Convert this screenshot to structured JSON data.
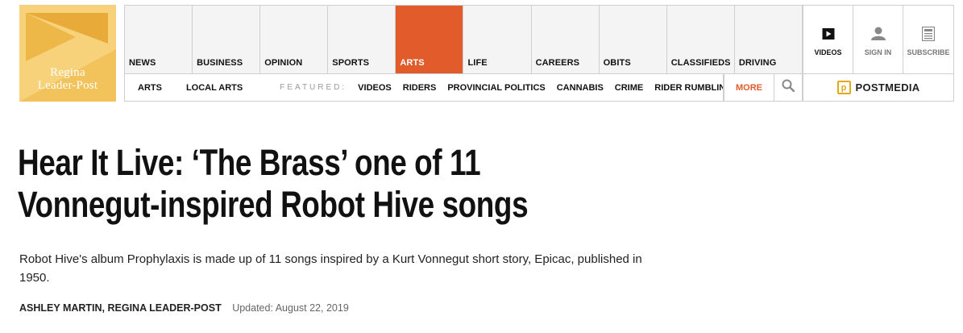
{
  "logo": {
    "line1": "Regina",
    "line2": "Leader-Post",
    "colors": {
      "base": "#f2c35a",
      "dark": "#e8ab3a",
      "light": "#f7d27a"
    }
  },
  "main_nav": [
    {
      "label": "NEWS",
      "active": false
    },
    {
      "label": "BUSINESS",
      "active": false
    },
    {
      "label": "OPINION",
      "active": false
    },
    {
      "label": "SPORTS",
      "active": false
    },
    {
      "label": "ARTS",
      "active": true
    },
    {
      "label": "LIFE",
      "active": false
    },
    {
      "label": "CAREERS",
      "active": false
    },
    {
      "label": "OBITS",
      "active": false
    },
    {
      "label": "CLASSIFIEDS",
      "active": false
    },
    {
      "label": "DRIVING",
      "active": false
    }
  ],
  "utility": {
    "videos": {
      "label": "VIDEOS",
      "icon": "play-icon"
    },
    "signin": {
      "label": "SIGN IN",
      "icon": "user-icon"
    },
    "subscribe": {
      "label": "SUBSCRIBE",
      "icon": "newspaper-icon"
    }
  },
  "sub_nav": {
    "arts": "ARTS",
    "local_arts": "LOCAL ARTS",
    "featured_label": "FEATURED:",
    "featured": [
      "VIDEOS",
      "RIDERS",
      "PROVINCIAL POLITICS",
      "CANNABIS",
      "CRIME",
      "RIDER RUMBLIN"
    ],
    "more": "MORE",
    "search_icon": "search-icon"
  },
  "postmedia": {
    "mark": "p",
    "label": "POSTMEDIA"
  },
  "article": {
    "headline": "Hear It Live: ‘The Brass’ one of 11 Vonnegut-inspired Robot Hive songs",
    "deck": "Robot Hive's album Prophylaxis is made up of 11 songs inspired by a Kurt Vonnegut short story, Epicac, published in 1950.",
    "author": "ASHLEY MARTIN, REGINA LEADER-POST",
    "updated": "Updated: August 22, 2019"
  },
  "colors": {
    "accent": "#e25b2b",
    "postmedia_gold": "#e5a81c",
    "nav_bg": "#f4f4f4",
    "border": "#cfcfcf"
  }
}
